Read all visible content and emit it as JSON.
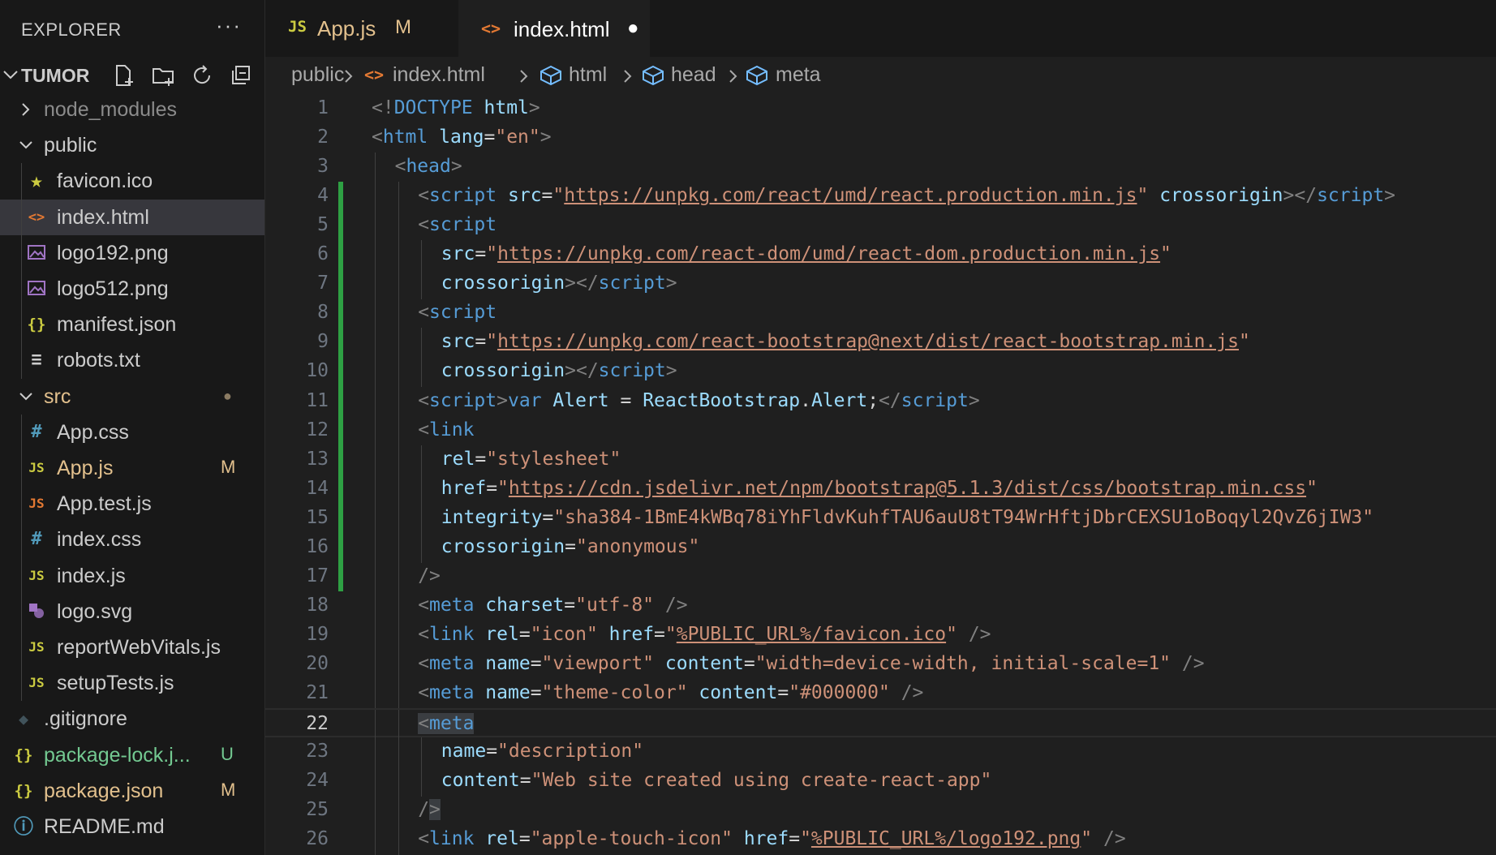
{
  "sidebar": {
    "title": "EXPLORER",
    "more": "···",
    "project": "TUMOR",
    "tree": [
      {
        "name": "node_modules",
        "kind": "folder",
        "open": false,
        "depth": 0,
        "color": "#8b8b8b"
      },
      {
        "name": "public",
        "kind": "folder",
        "open": true,
        "depth": 0,
        "color": "#cccccc"
      },
      {
        "name": "favicon.ico",
        "kind": "file",
        "icon": "star-icon",
        "depth": 1,
        "color": "#cccccc"
      },
      {
        "name": "index.html",
        "kind": "file",
        "icon": "html-icon",
        "depth": 1,
        "color": "#cccccc",
        "selected": true
      },
      {
        "name": "logo192.png",
        "kind": "file",
        "icon": "image-icon",
        "depth": 1,
        "color": "#cccccc"
      },
      {
        "name": "logo512.png",
        "kind": "file",
        "icon": "image-icon",
        "depth": 1,
        "color": "#cccccc"
      },
      {
        "name": "manifest.json",
        "kind": "file",
        "icon": "json-icon",
        "depth": 1,
        "color": "#cccccc"
      },
      {
        "name": "robots.txt",
        "kind": "file",
        "icon": "text-lines-icon",
        "depth": 1,
        "color": "#cccccc"
      },
      {
        "name": "src",
        "kind": "folder",
        "open": true,
        "depth": 0,
        "color": "#e2c08d",
        "badge": "●",
        "badge_color": "#8b7b63"
      },
      {
        "name": "App.css",
        "kind": "file",
        "icon": "css-icon",
        "depth": 1,
        "color": "#cccccc"
      },
      {
        "name": "App.js",
        "kind": "file",
        "icon": "js-icon",
        "depth": 1,
        "color": "#e2c08d",
        "badge": "M",
        "badge_color": "#e2c08d"
      },
      {
        "name": "App.test.js",
        "kind": "file",
        "icon": "js-test-icon",
        "depth": 1,
        "color": "#cccccc"
      },
      {
        "name": "index.css",
        "kind": "file",
        "icon": "css-icon",
        "depth": 1,
        "color": "#cccccc"
      },
      {
        "name": "index.js",
        "kind": "file",
        "icon": "js-icon",
        "depth": 1,
        "color": "#cccccc"
      },
      {
        "name": "logo.svg",
        "kind": "file",
        "icon": "svg-icon",
        "depth": 1,
        "color": "#cccccc"
      },
      {
        "name": "reportWebVitals.js",
        "kind": "file",
        "icon": "js-icon",
        "depth": 1,
        "color": "#cccccc"
      },
      {
        "name": "setupTests.js",
        "kind": "file",
        "icon": "js-icon",
        "depth": 1,
        "color": "#cccccc"
      },
      {
        "name": ".gitignore",
        "kind": "file",
        "icon": "git-icon",
        "depth": 0,
        "color": "#cccccc"
      },
      {
        "name": "package-lock.j...",
        "kind": "file",
        "icon": "json-icon",
        "depth": 0,
        "color": "#73c991",
        "badge": "U",
        "badge_color": "#73c991"
      },
      {
        "name": "package.json",
        "kind": "file",
        "icon": "json-icon",
        "depth": 0,
        "color": "#e2c08d",
        "badge": "M",
        "badge_color": "#e2c08d"
      },
      {
        "name": "README.md",
        "kind": "file",
        "icon": "info-icon",
        "depth": 0,
        "color": "#cccccc"
      }
    ]
  },
  "tabs": [
    {
      "label": "App.js",
      "icon": "JS",
      "status": "M",
      "active": false
    },
    {
      "label": "index.html",
      "icon": "<>",
      "status": "●",
      "active": true
    }
  ],
  "breadcrumb": [
    "public",
    "index.html",
    "html",
    "head",
    "meta"
  ],
  "editor": {
    "current_line": 22,
    "modified_lines": [
      4,
      17
    ],
    "lines": [
      {
        "n": 1,
        "indent": 0,
        "tokens": [
          [
            "b",
            "<!"
          ],
          [
            "tag",
            "DOCTYPE"
          ],
          [
            "txt",
            " "
          ],
          [
            "attr",
            "html"
          ],
          [
            "b",
            ">"
          ]
        ]
      },
      {
        "n": 2,
        "indent": 0,
        "tokens": [
          [
            "b",
            "<"
          ],
          [
            "tag",
            "html"
          ],
          [
            "txt",
            " "
          ],
          [
            "attr",
            "lang"
          ],
          [
            "eq",
            "="
          ],
          [
            "str",
            "\"en\""
          ],
          [
            "b",
            ">"
          ]
        ]
      },
      {
        "n": 3,
        "indent": 1,
        "tokens": [
          [
            "b",
            "<"
          ],
          [
            "tag",
            "head"
          ],
          [
            "b",
            ">"
          ]
        ]
      },
      {
        "n": 4,
        "indent": 2,
        "tokens": [
          [
            "b",
            "<"
          ],
          [
            "tag",
            "script"
          ],
          [
            "txt",
            " "
          ],
          [
            "attr",
            "src"
          ],
          [
            "eq",
            "="
          ],
          [
            "str",
            "\""
          ],
          [
            "link",
            "https://unpkg.com/react/umd/react.production.min.js"
          ],
          [
            "str",
            "\""
          ],
          [
            "txt",
            " "
          ],
          [
            "attr",
            "crossorigin"
          ],
          [
            "b",
            "></"
          ],
          [
            "tag",
            "script"
          ],
          [
            "b",
            ">"
          ]
        ]
      },
      {
        "n": 5,
        "indent": 2,
        "tokens": [
          [
            "b",
            "<"
          ],
          [
            "tag",
            "script"
          ]
        ]
      },
      {
        "n": 6,
        "indent": 3,
        "tokens": [
          [
            "attr",
            "src"
          ],
          [
            "eq",
            "="
          ],
          [
            "str",
            "\""
          ],
          [
            "link",
            "https://unpkg.com/react-dom/umd/react-dom.production.min.js"
          ],
          [
            "str",
            "\""
          ]
        ]
      },
      {
        "n": 7,
        "indent": 3,
        "tokens": [
          [
            "attr",
            "crossorigin"
          ],
          [
            "b",
            "></"
          ],
          [
            "tag",
            "script"
          ],
          [
            "b",
            ">"
          ]
        ]
      },
      {
        "n": 8,
        "indent": 2,
        "tokens": [
          [
            "b",
            "<"
          ],
          [
            "tag",
            "script"
          ]
        ]
      },
      {
        "n": 9,
        "indent": 3,
        "tokens": [
          [
            "attr",
            "src"
          ],
          [
            "eq",
            "="
          ],
          [
            "str",
            "\""
          ],
          [
            "link",
            "https://unpkg.com/react-bootstrap@next/dist/react-bootstrap.min.js"
          ],
          [
            "str",
            "\""
          ]
        ]
      },
      {
        "n": 10,
        "indent": 3,
        "tokens": [
          [
            "attr",
            "crossorigin"
          ],
          [
            "b",
            "></"
          ],
          [
            "tag",
            "script"
          ],
          [
            "b",
            ">"
          ]
        ]
      },
      {
        "n": 11,
        "indent": 2,
        "tokens": [
          [
            "b",
            "<"
          ],
          [
            "tag",
            "script"
          ],
          [
            "b",
            ">"
          ],
          [
            "kw",
            "var"
          ],
          [
            "txt",
            " "
          ],
          [
            "var",
            "Alert"
          ],
          [
            "txt",
            " = "
          ],
          [
            "var",
            "ReactBootstrap"
          ],
          [
            "txt",
            "."
          ],
          [
            "var",
            "Alert"
          ],
          [
            "txt",
            ";"
          ],
          [
            "b",
            "</"
          ],
          [
            "tag",
            "script"
          ],
          [
            "b",
            ">"
          ]
        ]
      },
      {
        "n": 12,
        "indent": 2,
        "tokens": [
          [
            "b",
            "<"
          ],
          [
            "tag",
            "link"
          ]
        ]
      },
      {
        "n": 13,
        "indent": 3,
        "tokens": [
          [
            "attr",
            "rel"
          ],
          [
            "eq",
            "="
          ],
          [
            "str",
            "\"stylesheet\""
          ]
        ]
      },
      {
        "n": 14,
        "indent": 3,
        "tokens": [
          [
            "attr",
            "href"
          ],
          [
            "eq",
            "="
          ],
          [
            "str",
            "\""
          ],
          [
            "link",
            "https://cdn.jsdelivr.net/npm/bootstrap@5.1.3/dist/css/bootstrap.min.css"
          ],
          [
            "str",
            "\""
          ]
        ]
      },
      {
        "n": 15,
        "indent": 3,
        "tokens": [
          [
            "attr",
            "integrity"
          ],
          [
            "eq",
            "="
          ],
          [
            "str",
            "\"sha384-1BmE4kWBq78iYhFldvKuhfTAU6auU8tT94WrHftjDbrCEXSU1oBoqyl2QvZ6jIW3\""
          ]
        ]
      },
      {
        "n": 16,
        "indent": 3,
        "tokens": [
          [
            "attr",
            "crossorigin"
          ],
          [
            "eq",
            "="
          ],
          [
            "str",
            "\"anonymous\""
          ]
        ]
      },
      {
        "n": 17,
        "indent": 2,
        "tokens": [
          [
            "b",
            "/>"
          ]
        ]
      },
      {
        "n": 18,
        "indent": 2,
        "tokens": [
          [
            "b",
            "<"
          ],
          [
            "tag",
            "meta"
          ],
          [
            "txt",
            " "
          ],
          [
            "attr",
            "charset"
          ],
          [
            "eq",
            "="
          ],
          [
            "str",
            "\"utf-8\""
          ],
          [
            "txt",
            " "
          ],
          [
            "b",
            "/>"
          ]
        ]
      },
      {
        "n": 19,
        "indent": 2,
        "tokens": [
          [
            "b",
            "<"
          ],
          [
            "tag",
            "link"
          ],
          [
            "txt",
            " "
          ],
          [
            "attr",
            "rel"
          ],
          [
            "eq",
            "="
          ],
          [
            "str",
            "\"icon\""
          ],
          [
            "txt",
            " "
          ],
          [
            "attr",
            "href"
          ],
          [
            "eq",
            "="
          ],
          [
            "str",
            "\""
          ],
          [
            "link",
            "%PUBLIC_URL%/favicon.ico"
          ],
          [
            "str",
            "\""
          ],
          [
            "txt",
            " "
          ],
          [
            "b",
            "/>"
          ]
        ]
      },
      {
        "n": 20,
        "indent": 2,
        "tokens": [
          [
            "b",
            "<"
          ],
          [
            "tag",
            "meta"
          ],
          [
            "txt",
            " "
          ],
          [
            "attr",
            "name"
          ],
          [
            "eq",
            "="
          ],
          [
            "str",
            "\"viewport\""
          ],
          [
            "txt",
            " "
          ],
          [
            "attr",
            "content"
          ],
          [
            "eq",
            "="
          ],
          [
            "str",
            "\"width=device-width, initial-scale=1\""
          ],
          [
            "txt",
            " "
          ],
          [
            "b",
            "/>"
          ]
        ]
      },
      {
        "n": 21,
        "indent": 2,
        "tokens": [
          [
            "b",
            "<"
          ],
          [
            "tag",
            "meta"
          ],
          [
            "txt",
            " "
          ],
          [
            "attr",
            "name"
          ],
          [
            "eq",
            "="
          ],
          [
            "str",
            "\"theme-color\""
          ],
          [
            "txt",
            " "
          ],
          [
            "attr",
            "content"
          ],
          [
            "eq",
            "="
          ],
          [
            "str",
            "\"#000000\""
          ],
          [
            "txt",
            " "
          ],
          [
            "b",
            "/>"
          ]
        ]
      },
      {
        "n": 22,
        "indent": 2,
        "tokens": [
          [
            "hlb",
            "<"
          ],
          [
            "hltag",
            "meta"
          ]
        ]
      },
      {
        "n": 23,
        "indent": 3,
        "tokens": [
          [
            "attr",
            "name"
          ],
          [
            "eq",
            "="
          ],
          [
            "str",
            "\"description\""
          ]
        ]
      },
      {
        "n": 24,
        "indent": 3,
        "tokens": [
          [
            "attr",
            "content"
          ],
          [
            "eq",
            "="
          ],
          [
            "str",
            "\"Web site created using create-react-app\""
          ]
        ]
      },
      {
        "n": 25,
        "indent": 2,
        "tokens": [
          [
            "b",
            "/"
          ],
          [
            "hlb",
            ">"
          ]
        ]
      },
      {
        "n": 26,
        "indent": 2,
        "tokens": [
          [
            "b",
            "<"
          ],
          [
            "tag",
            "link"
          ],
          [
            "txt",
            " "
          ],
          [
            "attr",
            "rel"
          ],
          [
            "eq",
            "="
          ],
          [
            "str",
            "\"apple-touch-icon\""
          ],
          [
            "txt",
            " "
          ],
          [
            "attr",
            "href"
          ],
          [
            "eq",
            "="
          ],
          [
            "str",
            "\""
          ],
          [
            "link",
            "%PUBLIC_URL%/logo192.png"
          ],
          [
            "str",
            "\""
          ],
          [
            "txt",
            " "
          ],
          [
            "b",
            "/>"
          ]
        ]
      }
    ]
  },
  "colors": {
    "modified": "#e2c08d",
    "untracked": "#73c991",
    "gutter_added": "#2ea043",
    "html_icon": "#e37933",
    "js_icon": "#cbcb41",
    "css_icon": "#519aba",
    "json_icon": "#cbcb41",
    "image_icon": "#a074c4"
  }
}
